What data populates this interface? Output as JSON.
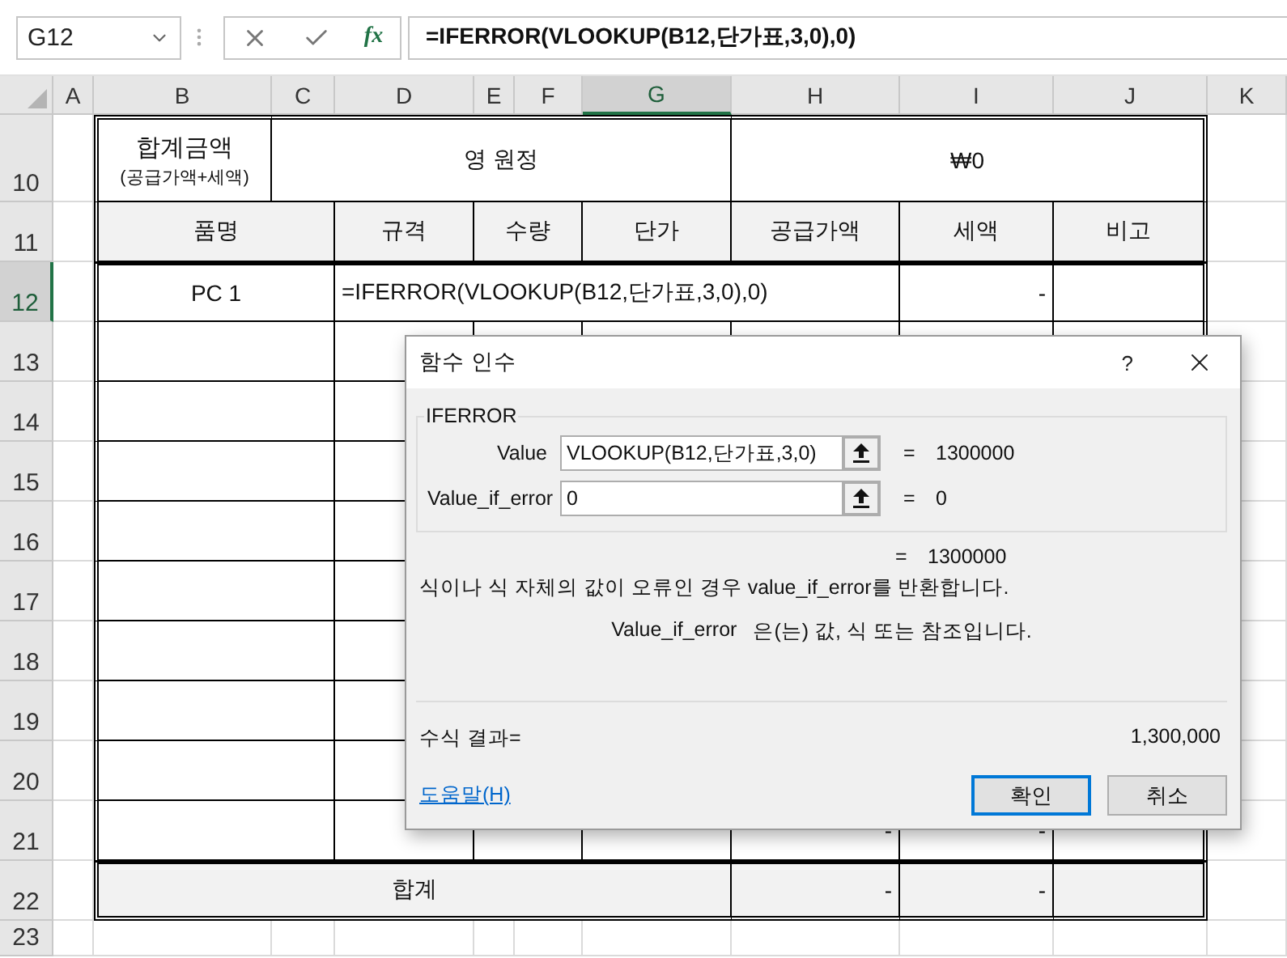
{
  "name_box": {
    "value": "G12"
  },
  "formula_bar": {
    "function_button": "fx",
    "value": "=IFERROR(VLOOKUP(B12,단가표,3,0),0)"
  },
  "columns": [
    {
      "label": "A",
      "selected": false
    },
    {
      "label": "B",
      "selected": false
    },
    {
      "label": "C",
      "selected": false
    },
    {
      "label": "D",
      "selected": false
    },
    {
      "label": "E",
      "selected": false
    },
    {
      "label": "F",
      "selected": false
    },
    {
      "label": "G",
      "selected": true
    },
    {
      "label": "H",
      "selected": false
    },
    {
      "label": "I",
      "selected": false
    },
    {
      "label": "J",
      "selected": false
    },
    {
      "label": "K",
      "selected": false
    }
  ],
  "rows": [
    {
      "header": "10",
      "selected": false,
      "kind": "total_amount",
      "label": "합계금액",
      "note": "(공급가액+세액)",
      "words": "영 원정",
      "amount": "₩0"
    },
    {
      "header": "11",
      "selected": false,
      "kind": "header",
      "headings": [
        "품명",
        "규격",
        "수량",
        "단가",
        "공급가액",
        "세액",
        "비고"
      ]
    },
    {
      "header": "12",
      "selected": true,
      "kind": "editing",
      "name": "PC 1",
      "formula": "=IFERROR(VLOOKUP(B12,단가표,3,0),0)",
      "tax": "-"
    },
    {
      "header": "13",
      "selected": false,
      "kind": "item"
    },
    {
      "header": "14",
      "selected": false,
      "kind": "item"
    },
    {
      "header": "15",
      "selected": false,
      "kind": "item"
    },
    {
      "header": "16",
      "selected": false,
      "kind": "item"
    },
    {
      "header": "17",
      "selected": false,
      "kind": "item"
    },
    {
      "header": "18",
      "selected": false,
      "kind": "item"
    },
    {
      "header": "19",
      "selected": false,
      "kind": "item"
    },
    {
      "header": "20",
      "selected": false,
      "kind": "item"
    },
    {
      "header": "21",
      "selected": false,
      "kind": "item",
      "supply": "-",
      "tax": "-"
    },
    {
      "header": "22",
      "selected": false,
      "kind": "total",
      "label": "합계",
      "supply": "-",
      "tax": "-"
    },
    {
      "header": "23",
      "selected": false,
      "kind": "blank"
    }
  ],
  "dialog": {
    "title": "함수 인수",
    "help": "?",
    "function_name": "IFERROR",
    "arguments": [
      {
        "label": "Value",
        "value": "VLOOKUP(B12,단가표,3,0)",
        "equals": "=",
        "result": "1300000"
      },
      {
        "label": "Value_if_error",
        "value": "0",
        "equals": "=",
        "result": "0"
      }
    ],
    "total": {
      "equals": "=",
      "result": "1300000"
    },
    "description": "식이나 식 자체의 값이 오류인 경우 value_if_error를 반환합니다.",
    "argument_name": "Value_if_error",
    "argument_description": "은(는) 값, 식 또는 참조입니다.",
    "formula_result_label": "수식 결과=",
    "formula_result": "1,300,000",
    "help_link": "도움말(H)",
    "buttons": [
      {
        "label": "확인",
        "default": true
      },
      {
        "label": "취소",
        "default": false
      }
    ]
  }
}
